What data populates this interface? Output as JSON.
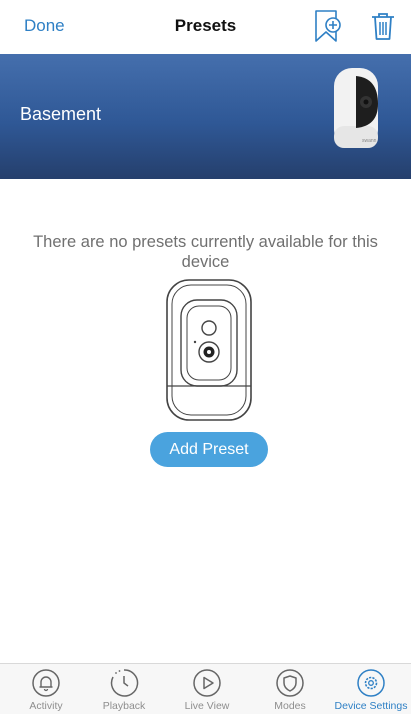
{
  "header": {
    "done_label": "Done",
    "title": "Presets",
    "add_icon": "bookmark-plus-icon",
    "delete_icon": "trash-icon"
  },
  "device": {
    "name": "Basement"
  },
  "empty_state": {
    "message": "There are no presets currently available for this device",
    "button_label": "Add Preset"
  },
  "tabs": [
    {
      "label": "Activity",
      "icon": "bell-icon",
      "active": false
    },
    {
      "label": "Playback",
      "icon": "clock-icon",
      "active": false
    },
    {
      "label": "Live View",
      "icon": "play-icon",
      "active": false
    },
    {
      "label": "Modes",
      "icon": "shield-icon",
      "active": false
    },
    {
      "label": "Device Settings",
      "icon": "gear-icon",
      "active": true
    }
  ],
  "colors": {
    "accent": "#2f80c5",
    "button": "#4aa3de",
    "banner": "#2f5896"
  }
}
